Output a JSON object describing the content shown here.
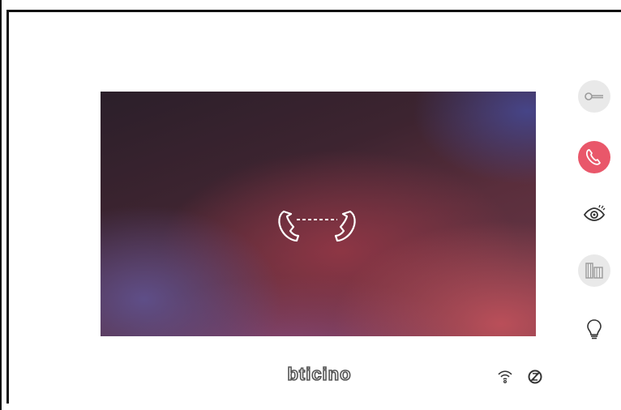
{
  "brand": {
    "logo_text": "bticino"
  },
  "colors": {
    "call_button": "#e9576a",
    "button_grey": "#e9e9e9",
    "icon_grey": "#9a9a9a",
    "icon_dark": "#333333"
  },
  "screen": {
    "icon": "intercom-call-handsets-icon"
  },
  "side_buttons": [
    {
      "name": "door-key-button",
      "icon": "key-icon"
    },
    {
      "name": "call-button",
      "icon": "phone-handset-icon"
    },
    {
      "name": "camera-view-button",
      "icon": "eye-icon"
    },
    {
      "name": "cameras-button",
      "icon": "gates-icon"
    },
    {
      "name": "light-button",
      "icon": "lightbulb-icon"
    }
  ],
  "status_bar": [
    {
      "name": "wifi-icon"
    },
    {
      "name": "do-not-disturb-icon"
    }
  ]
}
